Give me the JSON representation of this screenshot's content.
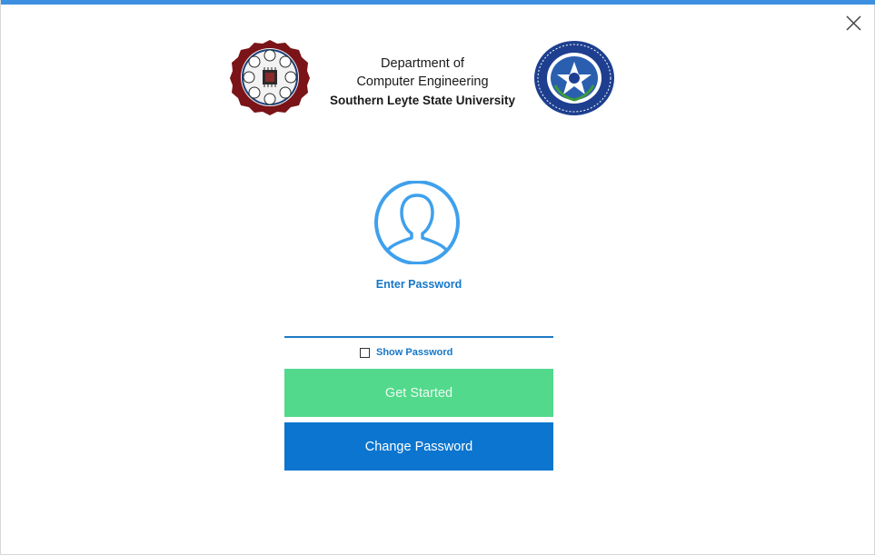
{
  "header": {
    "line1": "Department of",
    "line2": "Computer Engineering",
    "university": "Southern Leyte State University"
  },
  "icons": {
    "close": "close-icon",
    "avatar": "user-avatar-icon",
    "logo_left": "department-seal-logo",
    "logo_right": "university-seal-logo"
  },
  "login": {
    "prompt": "Enter Password",
    "password_value": "",
    "show_password_label": "Show Password",
    "show_password_checked": false,
    "get_started_label": "Get Started",
    "change_password_label": "Change Password"
  },
  "colors": {
    "accent": "#1577c8",
    "get_started": "#52d98c",
    "change_password": "#0b75cf",
    "avatar": "#3fa0ec"
  }
}
